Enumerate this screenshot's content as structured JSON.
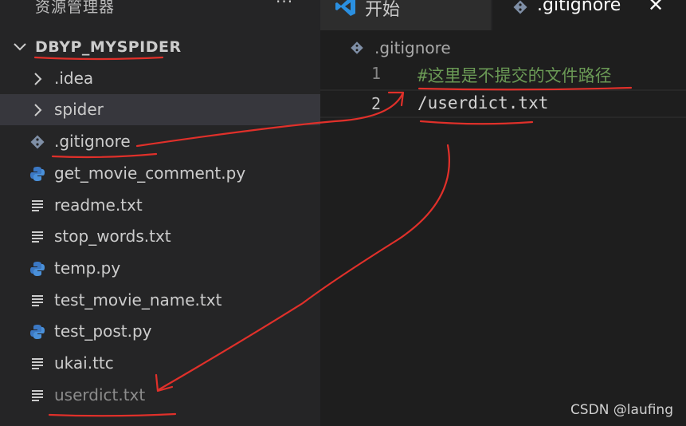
{
  "sidebar": {
    "title": "资源管理器",
    "more": "···",
    "section": "DBYP_MYSPIDER",
    "items": [
      {
        "label": ".idea",
        "icon": "chevron-right-icon"
      },
      {
        "label": "spider",
        "icon": "chevron-right-icon"
      },
      {
        "label": ".gitignore",
        "icon": "git-icon"
      },
      {
        "label": "get_movie_comment.py",
        "icon": "python-icon"
      },
      {
        "label": "readme.txt",
        "icon": "text-file-icon"
      },
      {
        "label": "stop_words.txt",
        "icon": "text-file-icon"
      },
      {
        "label": "temp.py",
        "icon": "python-icon"
      },
      {
        "label": "test_movie_name.txt",
        "icon": "text-file-icon"
      },
      {
        "label": "test_post.py",
        "icon": "python-icon"
      },
      {
        "label": "ukai.ttc",
        "icon": "text-file-icon"
      },
      {
        "label": "userdict.txt",
        "icon": "text-file-icon"
      }
    ]
  },
  "tabs": {
    "start_label": "开始",
    "active_label": ".gitignore",
    "close": "✕"
  },
  "editor": {
    "breadcrumb": ".gitignore",
    "lines": [
      {
        "num": "1",
        "text": "#这里是不提交的文件路径"
      },
      {
        "num": "2",
        "text": "/userdict.txt"
      }
    ]
  },
  "watermark": "CSDN @laufing",
  "colors": {
    "sidebar_bg": "#252526",
    "editor_bg": "#1e1e1e",
    "comment": "#6a9955",
    "annotation_red": "#e0302a",
    "python_blue": "#3b78c4",
    "vscode_blue": "#2a8fe0"
  }
}
